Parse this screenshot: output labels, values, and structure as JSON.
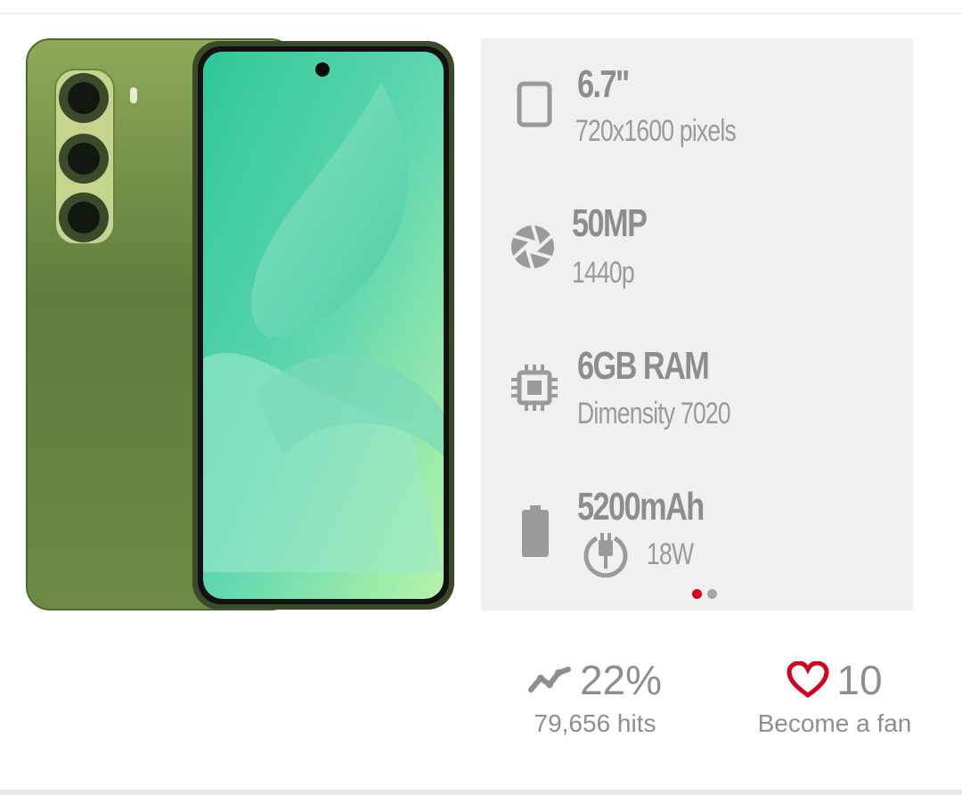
{
  "device_image": {
    "alt": "Phone image"
  },
  "specs": [
    {
      "icon": "screen-size-icon",
      "value": "6.7\"",
      "sub": "720x1600 pixels"
    },
    {
      "icon": "camera-aperture-icon",
      "value": "50MP",
      "sub": "1440p"
    },
    {
      "icon": "chipset-icon",
      "value": "6GB RAM",
      "sub": "Dimensity 7020"
    },
    {
      "icon": "battery-icon",
      "value": "5200mAh",
      "sub": "18W",
      "sub_icon": "charging-plug-icon"
    }
  ],
  "carousel": {
    "pages": 2,
    "active": 1
  },
  "stats": {
    "popularity": {
      "icon": "trend-icon",
      "value": "22%",
      "label": "79,656 hits"
    },
    "fans": {
      "icon": "heart-icon",
      "value": "10",
      "label": "Become a fan"
    }
  },
  "colors": {
    "accent": "#d5001c",
    "text_gray": "#8d8d8d",
    "panel_bg": "#f0f0f0"
  }
}
